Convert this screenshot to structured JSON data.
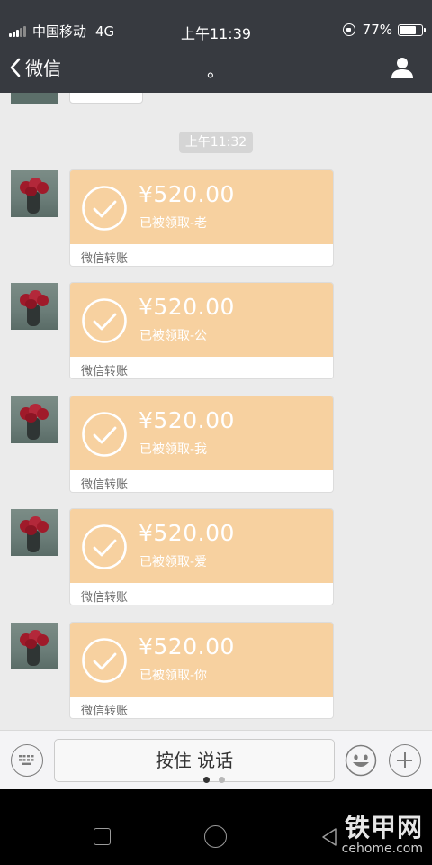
{
  "status_bar": {
    "carrier": "中国移动",
    "network": "4G",
    "time": "上午11:39",
    "battery": "77%",
    "battery_level": 0.77
  },
  "nav": {
    "back_label": "微信",
    "title": "。"
  },
  "chat": {
    "timestamp": "上午11:32",
    "messages": [
      {
        "amount": "¥520.00",
        "status": "已被领取-老",
        "label": "微信转账"
      },
      {
        "amount": "¥520.00",
        "status": "已被领取-公",
        "label": "微信转账"
      },
      {
        "amount": "¥520.00",
        "status": "已被领取-我",
        "label": "微信转账"
      },
      {
        "amount": "¥520.00",
        "status": "已被领取-爱",
        "label": "微信转账"
      },
      {
        "amount": "¥520.00",
        "status": "已被领取-你",
        "label": "微信转账"
      }
    ]
  },
  "input_bar": {
    "hold_to_talk": "按住 说话"
  },
  "watermark": {
    "brand": "铁甲网",
    "url": "cehome.com"
  },
  "colors": {
    "bar": "#373a40",
    "transfer": "#f7d1a0",
    "chat_bg": "#ebebeb"
  },
  "icons": [
    "back-chevron-icon",
    "profile-icon",
    "check-circle-icon",
    "keyboard-icon",
    "emoji-icon",
    "plus-icon",
    "recent-apps-icon",
    "home-icon",
    "back-triangle-icon"
  ]
}
